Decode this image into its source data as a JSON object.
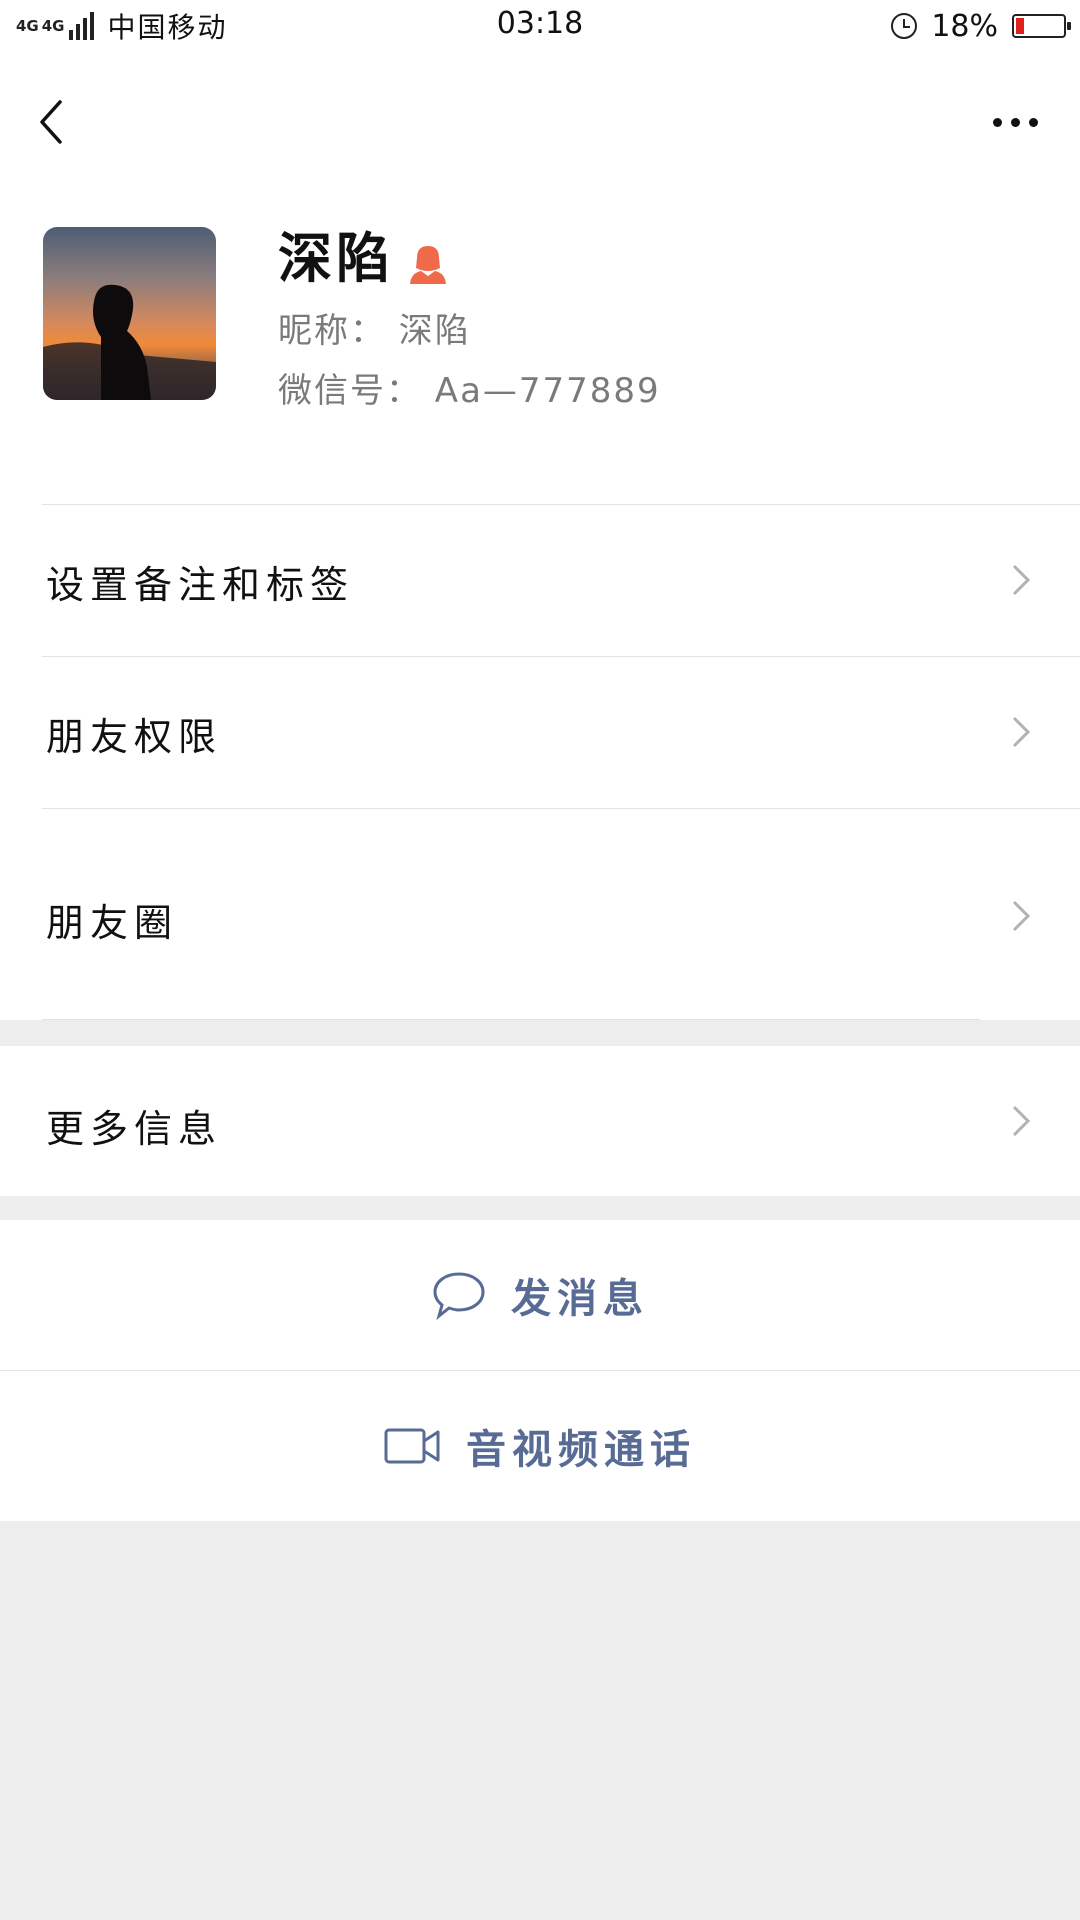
{
  "status_bar": {
    "network_top": "4G",
    "network_top2": "4G",
    "carrier": "中国移动",
    "time": "03:18",
    "battery_percent": "18%",
    "battery_level": 0.18,
    "alarm_icon": "alarm-clock-icon"
  },
  "nav": {
    "back_icon": "chevron-left-icon",
    "more_icon": "more-dots-icon"
  },
  "profile": {
    "name": "深陷",
    "gender_icon": "female-user-icon",
    "gender_color": "#f06a4a",
    "nickname": "昵称：  深陷",
    "wechat_id": "微信号：  Aa—777889"
  },
  "menu": {
    "remark_tags": "设置备注和标签",
    "friend_permissions": "朋友权限",
    "moments": "朋友圈",
    "more_info": "更多信息"
  },
  "actions": {
    "send_message": "发消息",
    "video_call": "音视频通话",
    "accent_color": "#576b95"
  }
}
